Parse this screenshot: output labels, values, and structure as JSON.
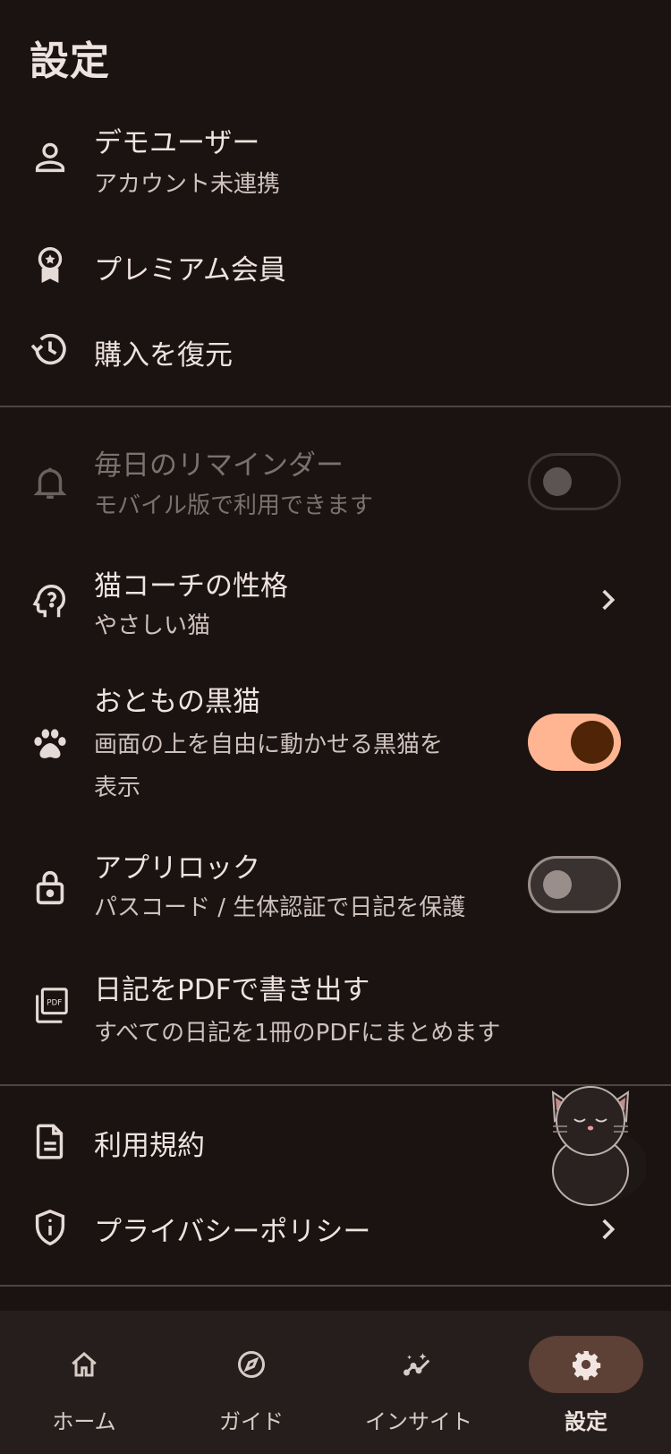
{
  "header": {
    "title": "設定"
  },
  "account": {
    "title": "デモユーザー",
    "subtitle": "アカウント未連携"
  },
  "premium": {
    "title": "プレミアム会員"
  },
  "restore": {
    "title": "購入を復元"
  },
  "reminder": {
    "title": "毎日のリマインダー",
    "subtitle": "モバイル版で利用できます",
    "enabled": false,
    "disabled": true
  },
  "coach": {
    "title": "猫コーチの性格",
    "subtitle": "やさしい猫"
  },
  "blackcat": {
    "title": "おともの黒猫",
    "subtitle_line1": "画面の上を自由に動かせる黒猫を",
    "subtitle_line2": "表示",
    "enabled": true
  },
  "applock": {
    "title": "アプリロック",
    "subtitle": "パスコード / 生体認証で日記を保護",
    "enabled": false
  },
  "pdf": {
    "title": "日記をPDFで書き出す",
    "subtitle": "すべての日記を1冊のPDFにまとめます",
    "icon_text": "PDF"
  },
  "terms": {
    "title": "利用規約"
  },
  "privacy": {
    "title": "プライバシーポリシー"
  },
  "nav": {
    "items": [
      {
        "label": "ホーム",
        "icon": "home-icon",
        "active": false
      },
      {
        "label": "ガイド",
        "icon": "compass-icon",
        "active": false
      },
      {
        "label": "インサイト",
        "icon": "insights-icon",
        "active": false
      },
      {
        "label": "設定",
        "icon": "gear-icon",
        "active": true
      }
    ]
  },
  "colors": {
    "background": "#1a1312",
    "toggle_on": "#ffb591",
    "toggle_on_knob": "#4f2407",
    "nav_active_pill": "#5d4036",
    "divider": "#4f4543"
  }
}
